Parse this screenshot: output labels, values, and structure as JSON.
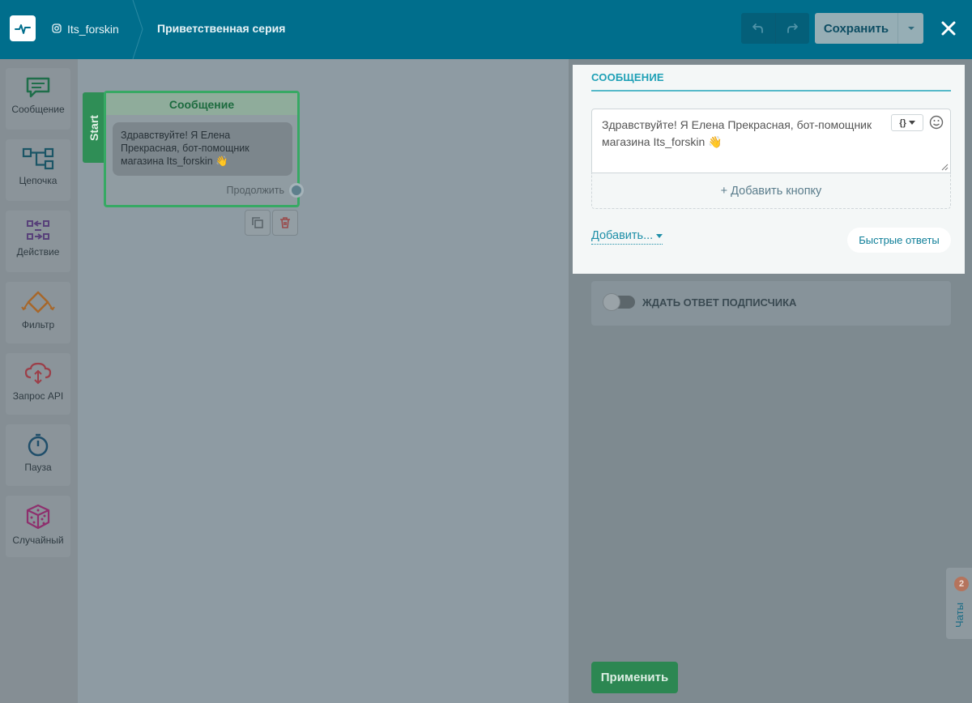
{
  "header": {
    "account_name": "Its_forskin",
    "page_title": "Приветственная серия",
    "save_label": "Сохранить"
  },
  "sidebar": {
    "items": [
      {
        "label": "Сообщение",
        "icon": "message-icon",
        "color": "#1f6e4a"
      },
      {
        "label": "Цепочка",
        "icon": "chain-icon",
        "color": "#1b5566"
      },
      {
        "label": "Действие",
        "icon": "action-icon",
        "color": "#58417a"
      },
      {
        "label": "Фильтр",
        "icon": "filter-icon",
        "color": "#a7672a"
      },
      {
        "label": "Запрос API",
        "icon": "api-cloud-icon",
        "color": "#9c3f49"
      },
      {
        "label": "Пауза",
        "icon": "timer-icon",
        "color": "#1f4e6a"
      },
      {
        "label": "Случайный",
        "icon": "dice-icon",
        "color": "#8e2f6d"
      }
    ]
  },
  "canvas": {
    "start_label": "Start",
    "node": {
      "title": "Сообщение",
      "text": "Здравствуйте! Я Елена Прекрасная, бот-помощник магазина Its_forskin 👋",
      "continue_label": "Продолжить"
    }
  },
  "panel": {
    "section_title": "СООБЩЕНИЕ",
    "message_text": "Здравствуйте! Я Елена Прекрасная, бот-помощник магазина Its_forskin 👋",
    "variable_label": "{}",
    "add_button_label": "+ Добавить кнопку",
    "add_menu_label": "Добавить...",
    "quick_replies_label": "Быстрые ответы",
    "wait_label": "ЖДАТЬ ОТВЕТ ПОДПИСЧИКА",
    "wait_enabled": false,
    "apply_label": "Применить"
  },
  "chats": {
    "label": "Чаты",
    "count": "2"
  },
  "colors": {
    "header": "#006e8c",
    "accent": "#1ea0b6",
    "node_border": "#37a964",
    "apply": "#2c8752"
  }
}
